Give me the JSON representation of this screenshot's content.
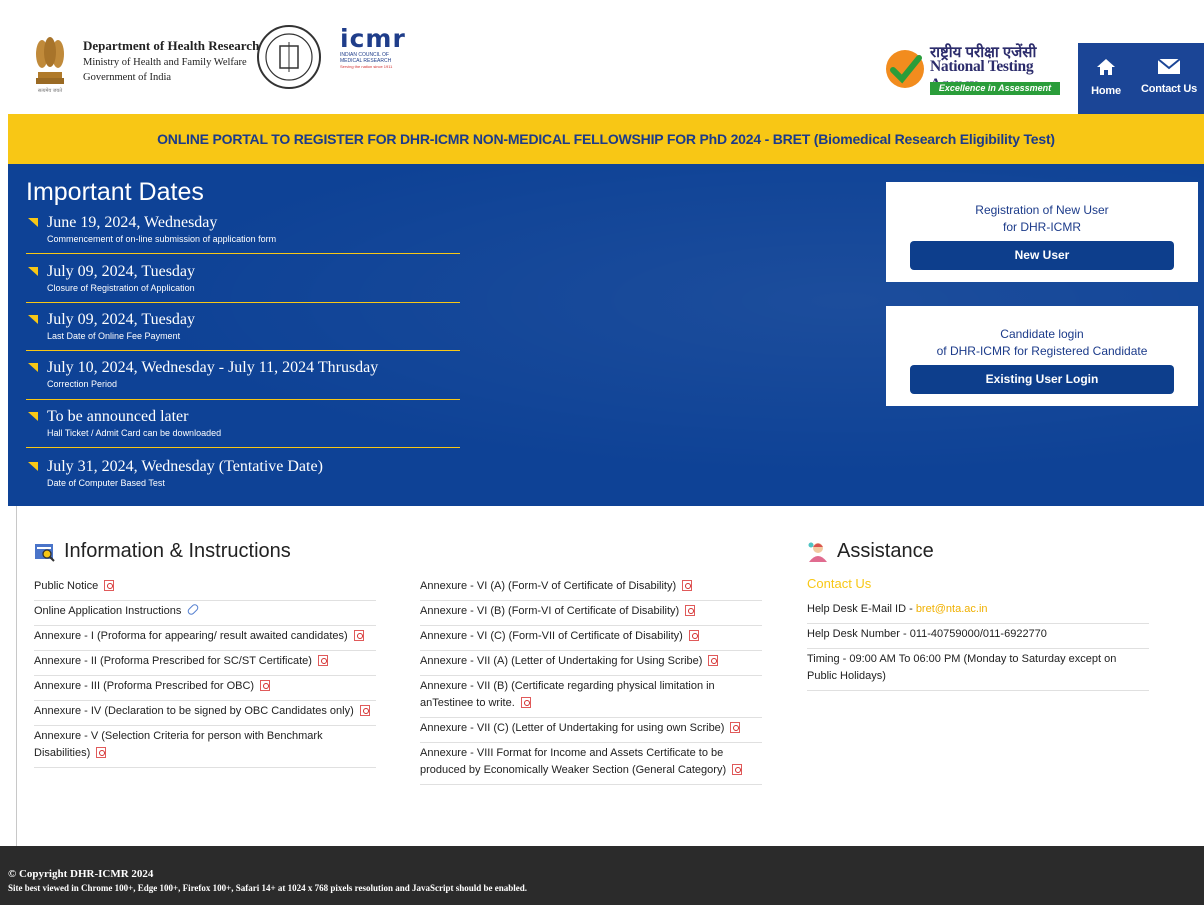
{
  "header": {
    "dhr_title": "Department of Health Research",
    "ministry": "Ministry of Health and Family Welfare",
    "gov": "Government of India",
    "icmr_logo": "icmr",
    "icmr_sub": "INDIAN COUNCIL OF MEDICAL RESEARCH",
    "icmr_tag": "Serving the nation since 1911",
    "nta_hindi": "राष्ट्रीय परीक्षा एजेंसी",
    "nta_english": "National Testing Agency",
    "nta_tagline": "Excellence in Assessment",
    "nav": {
      "home": "Home",
      "contact": "Contact Us"
    }
  },
  "banner": "ONLINE PORTAL TO REGISTER FOR DHR-ICMR NON-MEDICAL FELLOWSHIP FOR PhD 2024 - BRET (Biomedical Research Eligibility Test)",
  "dates": {
    "title": "Important Dates",
    "items": [
      {
        "date": "June 19, 2024, Wednesday",
        "desc": "Commencement of on-line submission of application form"
      },
      {
        "date": "July 09, 2024, Tuesday",
        "desc": "Closure of Registration of Application"
      },
      {
        "date": "July 09, 2024, Tuesday",
        "desc": "Last Date of Online Fee Payment"
      },
      {
        "date": "July 10, 2024, Wednesday - July 11, 2024 Thrusday",
        "desc": "Correction Period"
      },
      {
        "date": "To be announced later",
        "desc": "Hall Ticket / Admit Card can be downloaded"
      },
      {
        "date": "July 31, 2024, Wednesday (Tentative Date)",
        "desc": "Date of Computer Based Test"
      }
    ]
  },
  "cards": {
    "new_user": {
      "line1": "Registration of New User",
      "line2": "for DHR-ICMR",
      "button": "New User"
    },
    "login": {
      "line1": "Candidate login",
      "line2": "of DHR-ICMR for Registered Candidate",
      "button": "Existing User Login"
    }
  },
  "info": {
    "title": "Information & Instructions",
    "left": [
      "Public Notice",
      "Online Application Instructions",
      "Annexure - I (Proforma for appearing/ result awaited candidates)",
      "Annexure - II (Proforma Prescribed for SC/ST Certificate)",
      "Annexure - III (Proforma Prescribed for OBC)",
      "Annexure - IV (Declaration to be signed by OBC Candidates only)",
      "Annexure - V (Selection Criteria for person with Benchmark Disabilities)"
    ],
    "right": [
      "Annexure - VI (A) (Form-V of Certificate of Disability)",
      "Annexure - VI (B) (Form-VI of Certificate of Disability)",
      "Annexure - VI (C) (Form-VII of Certificate of Disability)",
      "Annexure - VII (A) (Letter of Undertaking for Using Scribe)",
      "Annexure - VII (B) (Certificate regarding physical limitation in anTestinee to write.",
      "Annexure - VII (C) (Letter of Undertaking for using own Scribe)",
      "Annexure - VIII Format for Income and Assets Certificate to be produced by Economically Weaker Section (General Category)"
    ]
  },
  "assistance": {
    "title": "Assistance",
    "contact_label": "Contact Us",
    "email_label": "Help Desk E-Mail ID -",
    "email": "bret@nta.ac.in",
    "phone": "Help Desk Number - 011-40759000/011-6922770",
    "timing": "Timing - 09:00 AM To 06:00 PM (Monday to Saturday except on Public Holidays)"
  },
  "footer": {
    "copyright": "© Copyright DHR-ICMR 2024",
    "note": "Site best viewed in Chrome 100+, Edge 100+, Firefox 100+, Safari 14+ at 1024 x 768 pixels resolution and JavaScript should be enabled."
  },
  "colors": {
    "navy": "#0e4296",
    "yellow": "#f8c715",
    "button": "#0d3e8c",
    "footer": "#2b2b2b",
    "nta_green": "#2a9d3a"
  }
}
